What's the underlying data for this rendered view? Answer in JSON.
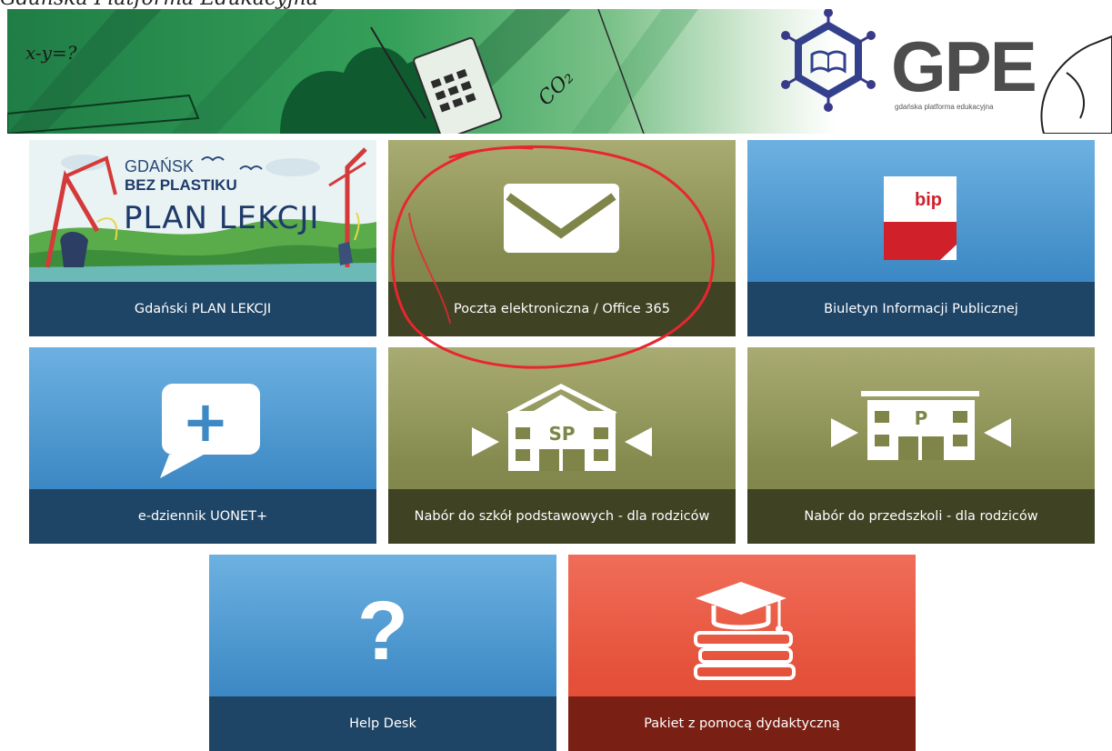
{
  "page": {
    "top_text": "Gdańska Platforma Edukacyjna"
  },
  "banner": {
    "logo_text": "GPE",
    "logo_subtitle": "gdańska platforma edukacyjna",
    "doodle_formula": "x-y=?",
    "doodle_co2": "CO₂"
  },
  "tiles": [
    {
      "label": "Gdański PLAN LEKCJI",
      "color": "blue",
      "artwork": {
        "line1": "GDAŃSK",
        "line2": "BEZ PLASTIKU",
        "line3": "PLAN LEKCJI"
      }
    },
    {
      "label": "Poczta elektroniczna / Office 365",
      "color": "olive",
      "icon": "envelope-icon"
    },
    {
      "label": "Biuletyn Informacji Publicznej",
      "color": "blue",
      "icon": "bip-icon",
      "icon_text": "bip"
    },
    {
      "label": "e-dziennik UONET+",
      "color": "blue",
      "icon": "speech-bubble-plus-icon",
      "icon_text": "+"
    },
    {
      "label": "Nabór do szkół podstawowych - dla rodziców",
      "color": "olive",
      "icon": "school-building-icon",
      "icon_text": "SP"
    },
    {
      "label": "Nabór do przedszkoli - dla rodziców",
      "color": "olive",
      "icon": "kindergarten-building-icon",
      "icon_text": "P"
    },
    {
      "label": "Help Desk",
      "color": "blue",
      "icon": "question-mark-icon",
      "icon_text": "?"
    },
    {
      "label": "Pakiet z pomocą dydaktyczną",
      "color": "red",
      "icon": "graduation-books-icon"
    }
  ],
  "colors": {
    "blue_tile": "#3d89c5",
    "olive_tile": "#848a4e",
    "red_tile": "#e5513a",
    "annotation": "#e8262f"
  }
}
